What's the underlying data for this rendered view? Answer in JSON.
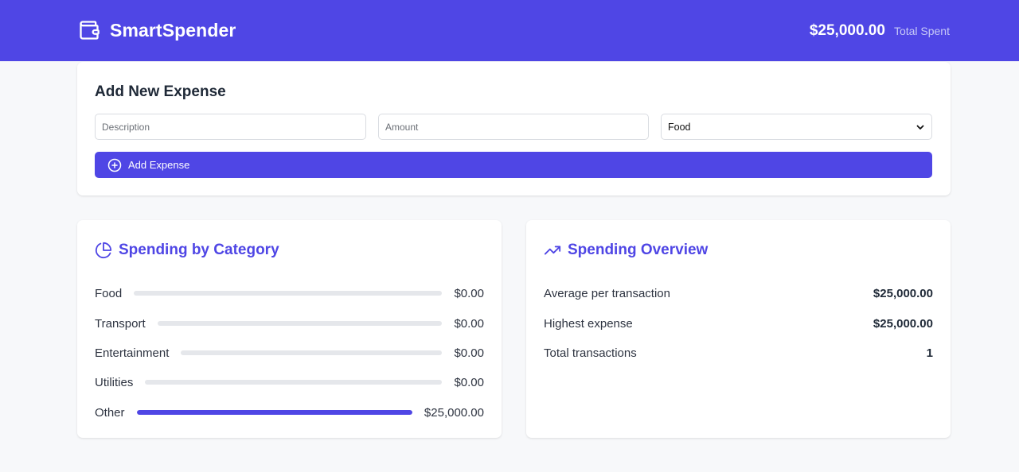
{
  "app": {
    "name": "SmartSpender",
    "icon": "wallet-icon"
  },
  "header": {
    "total_amount": "$25,000.00",
    "total_label": "Total Spent"
  },
  "add_expense": {
    "title": "Add New Expense",
    "description_placeholder": "Description",
    "amount_placeholder": "Amount",
    "category_selected": "Food",
    "button_label": "Add Expense",
    "button_icon": "plus-circle-icon"
  },
  "category_section": {
    "title": "Spending by Category",
    "icon": "pie-chart-icon",
    "items": [
      {
        "name": "Food",
        "amount": "$0.00",
        "share": 0
      },
      {
        "name": "Transport",
        "amount": "$0.00",
        "share": 0
      },
      {
        "name": "Entertainment",
        "amount": "$0.00",
        "share": 0
      },
      {
        "name": "Utilities",
        "amount": "$0.00",
        "share": 0
      },
      {
        "name": "Other",
        "amount": "$25,000.00",
        "share": 1
      }
    ]
  },
  "overview_section": {
    "title": "Spending Overview",
    "icon": "trending-up-icon",
    "rows": [
      {
        "label": "Average per transaction",
        "value": "$25,000.00"
      },
      {
        "label": "Highest expense",
        "value": "$25,000.00"
      },
      {
        "label": "Total transactions",
        "value": "1"
      }
    ]
  },
  "colors": {
    "accent": "#4f46e5",
    "background": "#f7f8fa",
    "track": "#e5e7eb"
  }
}
